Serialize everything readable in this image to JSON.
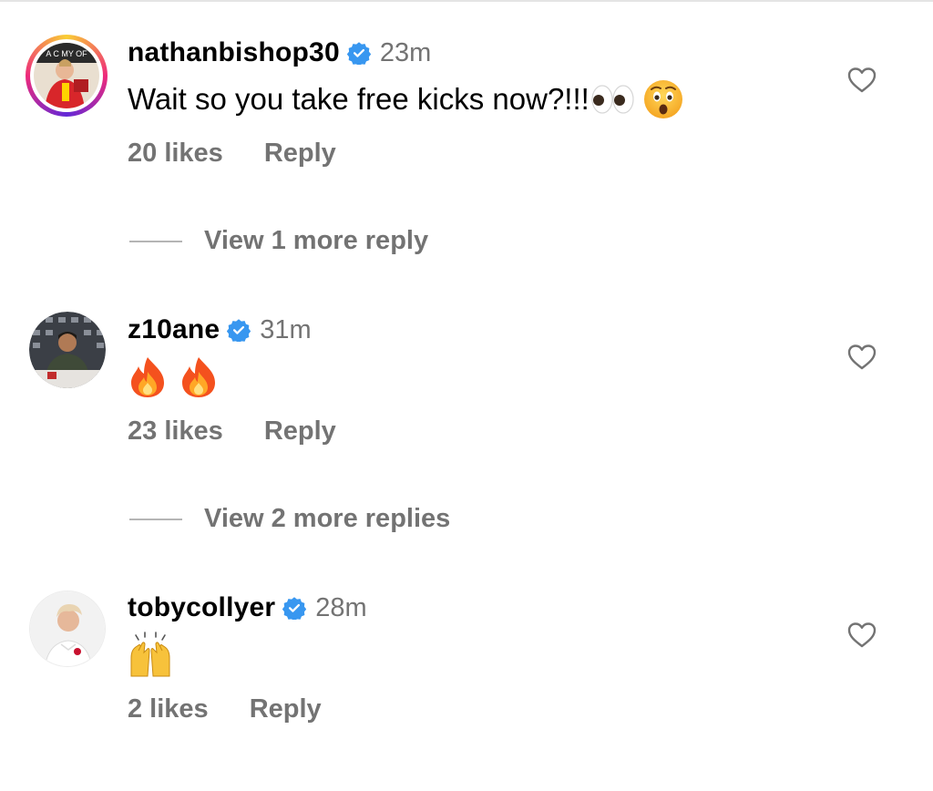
{
  "comments": [
    {
      "username": "nathanbishop30",
      "time": "23m",
      "text": "Wait so you take free kicks now?!!!",
      "emoji": [
        "eyes-emoji",
        "astonished-face-emoji"
      ],
      "likes": "20 likes",
      "reply": "Reply",
      "view_replies": "View 1 more reply"
    },
    {
      "username": "z10ane",
      "time": "31m",
      "text": "",
      "emoji": [
        "fire-emoji",
        "fire-emoji"
      ],
      "likes": "23 likes",
      "reply": "Reply",
      "view_replies": "View 2 more replies"
    },
    {
      "username": "tobycollyer",
      "time": "28m",
      "text": "",
      "emoji": [
        "raising-hands-emoji"
      ],
      "likes": "2 likes",
      "reply": "Reply"
    }
  ],
  "colors": {
    "verified_blue": "#3897f0",
    "secondary_text": "#737373"
  }
}
